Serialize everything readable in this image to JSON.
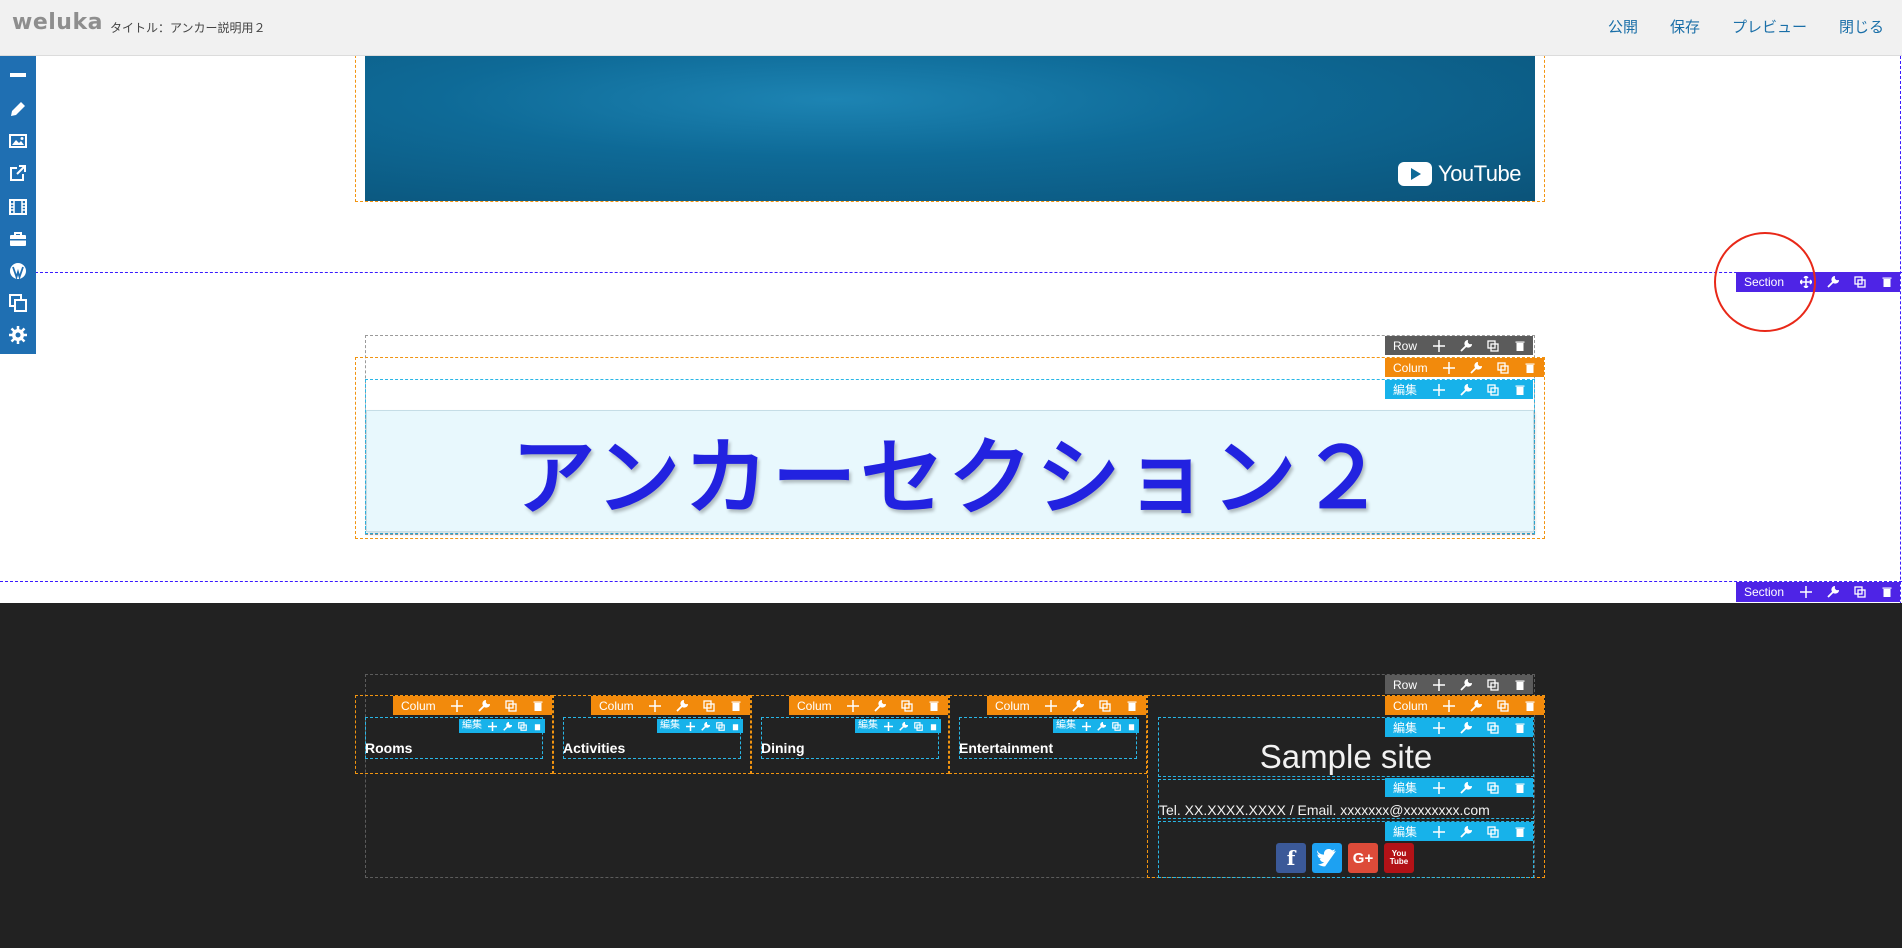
{
  "header": {
    "logo": "weluka",
    "title": "タイトル：アンカー説明用２",
    "nav": [
      "公開",
      "保存",
      "プレビュー",
      "閉じる"
    ]
  },
  "sidebar": {
    "tools": [
      "minus-icon",
      "pencil-icon",
      "image-icon",
      "external-link-icon",
      "film-icon",
      "briefcase-icon",
      "wordpress-icon",
      "copy-icon",
      "gear-icon"
    ]
  },
  "video": {
    "brand": "YouTube"
  },
  "controls": {
    "section": "Section",
    "row": "Row",
    "column": "Colum",
    "edit": "編集"
  },
  "anchor_section": {
    "heading": "アンカーセクション２"
  },
  "footer": {
    "categories": [
      "Rooms",
      "Activities",
      "Dining",
      "Entertainment"
    ],
    "site_title": "Sample site",
    "contact": "Tel. XX.XXXX.XXXX / Email. xxxxxxx@xxxxxxxx.com",
    "social": [
      {
        "name": "facebook",
        "glyph": "f",
        "color": "#3b5998"
      },
      {
        "name": "twitter",
        "glyph": "t",
        "color": "#1da1f2"
      },
      {
        "name": "google-plus",
        "glyph": "G+",
        "color": "#dd4b39"
      },
      {
        "name": "youtube",
        "glyph": "You Tube",
        "color": "#b31217"
      }
    ]
  },
  "colors": {
    "accent_blue": "#1f6fb2",
    "section_purple": "#4e24e6",
    "column_orange": "#f28a0c",
    "edit_cyan": "#17b2ea",
    "heading_blue": "#2222e0"
  }
}
